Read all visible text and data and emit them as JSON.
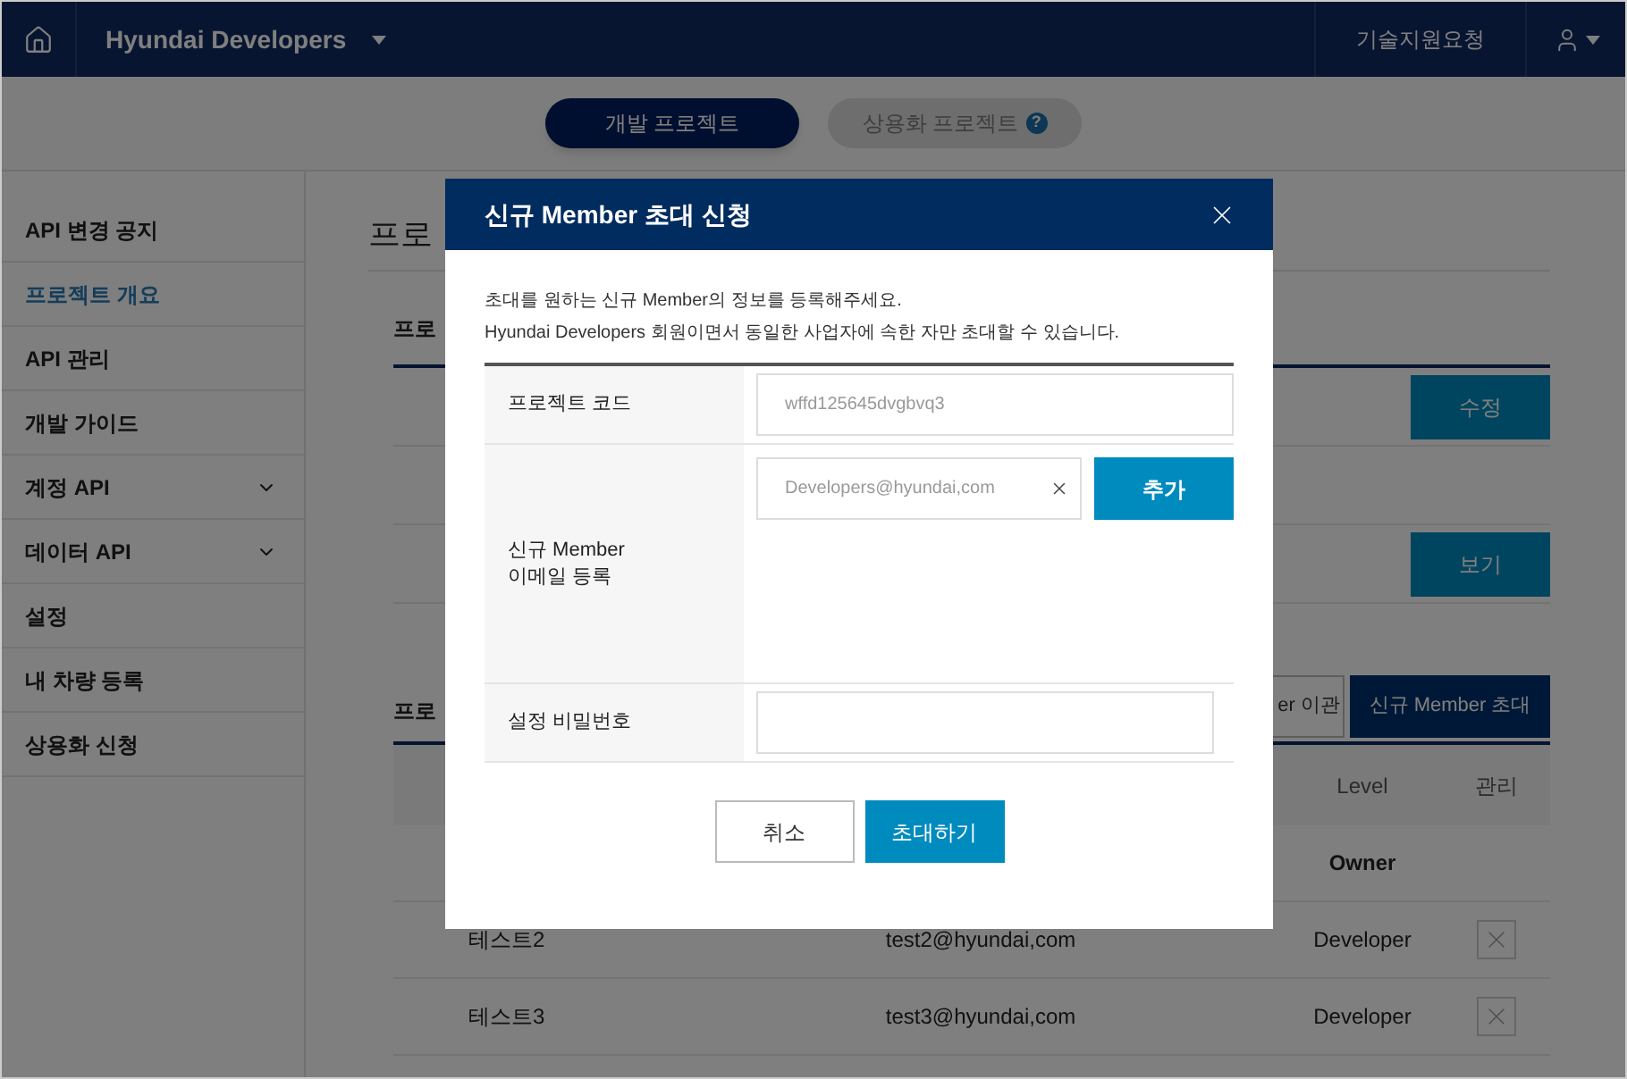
{
  "header": {
    "brand": "Hyundai Developers",
    "support_link": "기술지원요청"
  },
  "project_tabs": [
    {
      "label": "개발 프로젝트",
      "selected": true
    },
    {
      "label": "상용화 프로젝트",
      "selected": false,
      "badge": "?"
    }
  ],
  "sidebar": {
    "items": [
      {
        "label": "API 변경 공지",
        "selected": false,
        "expandable": false
      },
      {
        "label": "프로젝트 개요",
        "selected": true,
        "expandable": false
      },
      {
        "label": "API 관리",
        "selected": false,
        "expandable": false
      },
      {
        "label": "개발 가이드",
        "selected": false,
        "expandable": false
      },
      {
        "label": "계정 API",
        "selected": false,
        "expandable": true
      },
      {
        "label": "데이터 API",
        "selected": false,
        "expandable": true
      },
      {
        "label": "설정",
        "selected": false,
        "expandable": false
      },
      {
        "label": "내 차량 등록",
        "selected": false,
        "expandable": false
      },
      {
        "label": "상용화 신청",
        "selected": false,
        "expandable": false
      }
    ]
  },
  "content": {
    "title": "프로",
    "info_section": {
      "title": "프로",
      "buttons": [
        "수정",
        "보기"
      ]
    },
    "member_section": {
      "title": "프로",
      "actions": [
        {
          "label": "er 이관",
          "kind": "outline"
        },
        {
          "label": "신규 Member 초대",
          "kind": "primary"
        }
      ],
      "columns": [
        "Level",
        "관리"
      ],
      "rows": [
        {
          "level": "Owner",
          "owner": true,
          "removable": false
        },
        {
          "name": "테스트2",
          "email": "test2@hyundai,com",
          "level": "Developer",
          "owner": false,
          "removable": true
        },
        {
          "name": "테스트3",
          "email": "test3@hyundai,com",
          "level": "Developer",
          "owner": false,
          "removable": true
        }
      ]
    }
  },
  "modal": {
    "title": "신규 Member 초대 신청",
    "description": [
      "초대를 원하는 신규 Member의 정보를 등록해주세요.",
      "Hyundai Developers 회원이면서 동일한 사업자에 속한 자만 초대할 수 있습니다."
    ],
    "fields": [
      {
        "kind": "code",
        "label": "프로젝트 코드",
        "value": "wffd125645dvgbvq3"
      },
      {
        "kind": "email",
        "label": "신규 Member\n이메일 등록",
        "placeholder": "Developers@hyundai,com",
        "button": "추가"
      },
      {
        "kind": "password",
        "label": "설정 비밀번호"
      }
    ],
    "buttons": [
      {
        "label": "취소",
        "kind": "secondary"
      },
      {
        "label": "초대하기",
        "kind": "primary"
      }
    ]
  }
}
